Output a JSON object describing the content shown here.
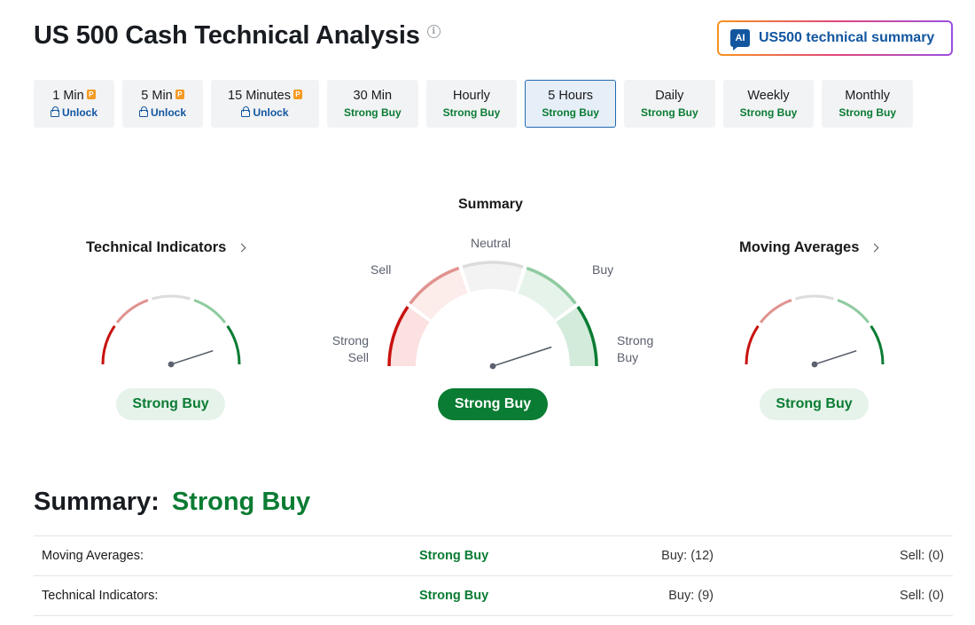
{
  "page": {
    "title": "US 500 Cash Technical Analysis",
    "info_icon": "info-icon",
    "ai_button": {
      "badge": "AI",
      "label": "US500 technical summary"
    }
  },
  "timeframes": [
    {
      "name": "1 Min",
      "status": "Unlock",
      "locked": true,
      "active": false
    },
    {
      "name": "5 Min",
      "status": "Unlock",
      "locked": true,
      "active": false
    },
    {
      "name": "15 Minutes",
      "status": "Unlock",
      "locked": true,
      "active": false
    },
    {
      "name": "30 Min",
      "status": "Strong Buy",
      "locked": false,
      "active": false
    },
    {
      "name": "Hourly",
      "status": "Strong Buy",
      "locked": false,
      "active": false
    },
    {
      "name": "5 Hours",
      "status": "Strong Buy",
      "locked": false,
      "active": true
    },
    {
      "name": "Daily",
      "status": "Strong Buy",
      "locked": false,
      "active": false
    },
    {
      "name": "Weekly",
      "status": "Strong Buy",
      "locked": false,
      "active": false
    },
    {
      "name": "Monthly",
      "status": "Strong Buy",
      "locked": false,
      "active": false
    }
  ],
  "gauges": {
    "technical": {
      "title": "Technical Indicators",
      "result": "Strong Buy",
      "needle_level": 0.9
    },
    "summary": {
      "title": "Summary",
      "result": "Strong Buy",
      "needle_level": 0.9,
      "labels": {
        "strong_sell": "Strong\nSell",
        "sell": "Sell",
        "neutral": "Neutral",
        "buy": "Buy",
        "strong_buy": "Strong\nBuy"
      }
    },
    "moving": {
      "title": "Moving Averages",
      "result": "Strong Buy",
      "needle_level": 0.9
    }
  },
  "colors": {
    "strong_sell": "#c8120f",
    "sell": "#e0938f",
    "neutral": "#dcdcdc",
    "buy": "#8fcba0",
    "strong_buy": "#0a7c33",
    "needle": "#5b616e"
  },
  "summary_line": {
    "label": "Summary:",
    "value": "Strong Buy"
  },
  "table": [
    {
      "name": "Moving Averages:",
      "result": "Strong Buy",
      "buy": "Buy: (12)",
      "sell": "Sell: (0)"
    },
    {
      "name": "Technical Indicators:",
      "result": "Strong Buy",
      "buy": "Buy: (9)",
      "sell": "Sell: (0)"
    }
  ]
}
